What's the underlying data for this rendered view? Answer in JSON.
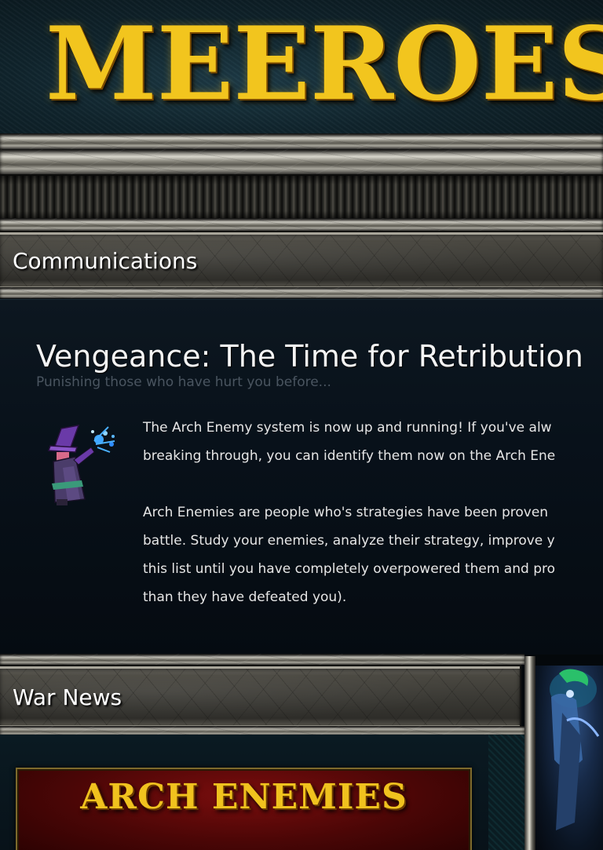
{
  "header": {
    "logo_text": "MEEROES"
  },
  "sections": {
    "communications": {
      "title": "Communications"
    },
    "war_news": {
      "title": "War News"
    }
  },
  "article": {
    "headline": "Vengeance: The Time for Retribution",
    "subheading": "Punishing those who have hurt you before...",
    "paragraph1_line1": "The Arch Enemy system is now up and running! If you've alw",
    "paragraph1_line2": "breaking through, you can identify them now on the Arch Ene",
    "paragraph2_line1": "Arch Enemies are people who's strategies have been proven",
    "paragraph2_line2": "battle. Study your enemies, analyze their strategy, improve y",
    "paragraph2_line3": "this list until you have completely overpowered them and pro",
    "paragraph2_line4": "than they have defeated you)."
  },
  "banner": {
    "title": "ARCH ENEMIES"
  },
  "colors": {
    "logo_gold": "#f2c51e",
    "panel_dark": "#08111a",
    "banner_red": "#6a0a0a"
  }
}
